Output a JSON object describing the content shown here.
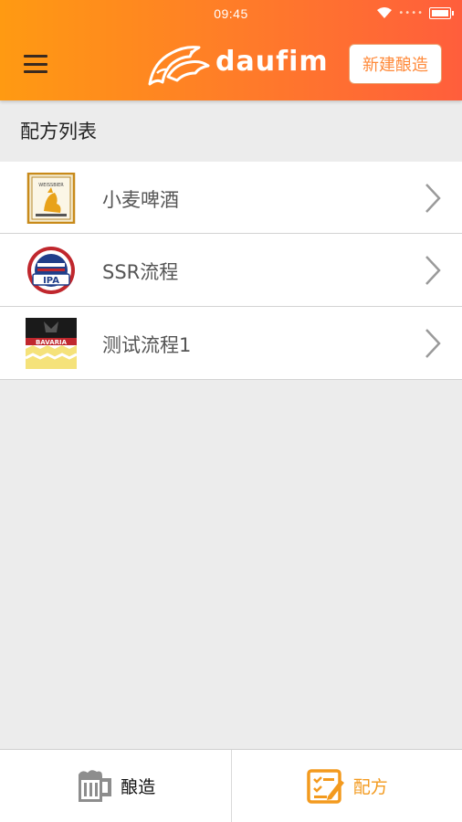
{
  "status_bar": {
    "time": "09:45",
    "extra_dots": "••••"
  },
  "header": {
    "logo_text": "daufim",
    "new_brew_button": "新建酿造"
  },
  "section": {
    "title": "配方列表"
  },
  "recipes": [
    {
      "name": "小麦啤酒",
      "badge_text": "WEISSBIER"
    },
    {
      "name": "SSR流程",
      "badge_text": "IPA"
    },
    {
      "name": "测试流程1",
      "badge_text": "BAVARIA"
    }
  ],
  "tabbar": {
    "tabs": [
      {
        "label": "酿造",
        "icon": "beer-mug-icon"
      },
      {
        "label": "配方",
        "icon": "recipe-edit-icon"
      }
    ]
  },
  "colors": {
    "header_start": "#ff9a12",
    "header_end": "#ff5e3c",
    "accent": "#f39a1e"
  }
}
